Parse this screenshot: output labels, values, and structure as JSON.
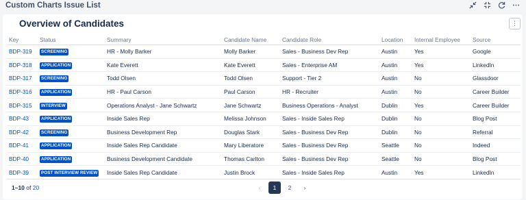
{
  "gadget": {
    "title": "Custom Charts Issue List",
    "actions": [
      {
        "name": "minimize-icon",
        "glyph": "⤡"
      },
      {
        "name": "collapse-icon",
        "glyph": "⊹"
      },
      {
        "name": "refresh-icon",
        "glyph": "↻"
      },
      {
        "name": "more-options-icon",
        "glyph": "⋯"
      }
    ]
  },
  "card": {
    "title": "Overview of Candidates",
    "more_glyph": "⋮"
  },
  "table": {
    "columns": [
      "Key",
      "Status",
      "Summary",
      "Candidate Name",
      "Candidate Role",
      "Location",
      "Internal Employee",
      "Source"
    ],
    "rows": [
      {
        "key": "BDP-319",
        "status": "SCREENING",
        "summary": "HR - Molly Barker",
        "name": "Molly Barker",
        "role": "Sales - Business Dev Rep",
        "location": "Austin",
        "internal": "Yes",
        "source": "Google"
      },
      {
        "key": "BDP-318",
        "status": "APPLICATION",
        "summary": "Kate Everett",
        "name": "Kate Everett",
        "role": "Sales - Enterprise AM",
        "location": "Austin",
        "internal": "Yes",
        "source": "LinkedIn"
      },
      {
        "key": "BDP-317",
        "status": "SCREENING",
        "summary": "Todd Olsen",
        "name": "Todd Olsen",
        "role": "Support - Tier 2",
        "location": "Austin",
        "internal": "No",
        "source": "Glassdoor"
      },
      {
        "key": "BDP-316",
        "status": "APPLICATION",
        "summary": "HR - Paul Carson",
        "name": "Paul Carson",
        "role": "HR - Recruiter",
        "location": "Austin",
        "internal": "No",
        "source": "Career Builder"
      },
      {
        "key": "BDP-315",
        "status": "INTERVIEW",
        "summary": "Operations Analyst - Jane Schwartz",
        "name": "Jane Schwartz",
        "role": "Business Operations - Analyst",
        "location": "Dublin",
        "internal": "Yes",
        "source": "Career Builder"
      },
      {
        "key": "BDP-43",
        "status": "APPLICATION",
        "summary": "Inside Sales Rep",
        "name": "Melissa Johnson",
        "role": "Sales - Inside Sales Rep",
        "location": "Dublin",
        "internal": "No",
        "source": "Blog Post"
      },
      {
        "key": "BDP-42",
        "status": "SCREENING",
        "summary": "Business Development Rep",
        "name": "Douglas Stark",
        "role": "Sales - Business Dev Rep",
        "location": "Dublin",
        "internal": "No",
        "source": "Referral"
      },
      {
        "key": "BDP-41",
        "status": "APPLICATION",
        "summary": "Inside Sales Rep Candidate",
        "name": "Mary Liberatore",
        "role": "Sales - Business Dev Rep",
        "location": "Seattle",
        "internal": "No",
        "source": "Indeed"
      },
      {
        "key": "BDP-40",
        "status": "APPLICATION",
        "summary": "Business Development Candidate",
        "name": "Thomas Carlton",
        "role": "Sales - Business Dev Rep",
        "location": "Seattle",
        "internal": "No",
        "source": "Blog Post"
      },
      {
        "key": "BDP-39",
        "status": "POST INTERVIEW REVIEW",
        "summary": "Inside Sales Rep Candidate",
        "name": "Justin Brock",
        "role": "Sales - Inside Sales Rep",
        "location": "Austin",
        "internal": "Yes",
        "source": "LinkedIn"
      }
    ]
  },
  "footer": {
    "range": "1–10",
    "of_label": "of",
    "total": "20"
  },
  "pagination": {
    "prev_glyph": "‹",
    "pages": [
      "1",
      "2"
    ],
    "current": "1",
    "next_glyph": "›"
  },
  "colors": {
    "link": "#0052cc",
    "lozenge": "#0052cc",
    "active_page": "#253858"
  }
}
